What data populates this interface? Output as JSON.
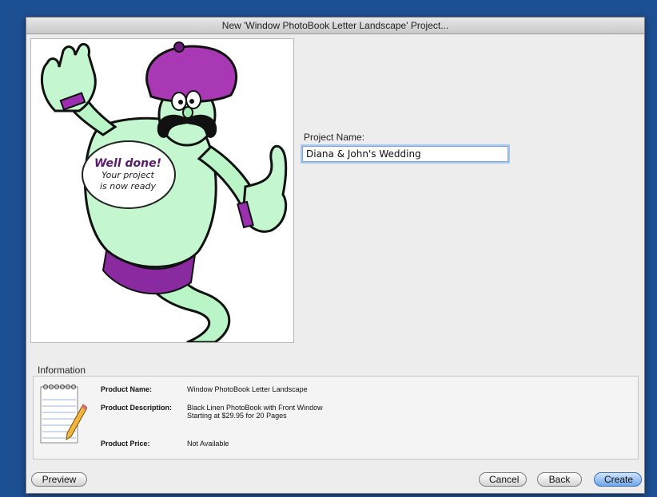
{
  "window": {
    "title": "New 'Window PhotoBook Letter Landscape' Project..."
  },
  "illustration": {
    "bubble_title": "Well done!",
    "bubble_line1": "Your project",
    "bubble_line2": "is now ready"
  },
  "project_name": {
    "label": "Project Name:",
    "value": "Diana & John's Wedding"
  },
  "information": {
    "title": "Information",
    "product_name_label": "Product Name:",
    "product_name_value": "Window PhotoBook Letter Landscape",
    "product_description_label": "Product Description:",
    "product_description_line1": "Black Linen PhotoBook with Front Window",
    "product_description_line2": "Starting at $29.95 for 20 Pages",
    "product_price_label": "Product Price:",
    "product_price_value": "Not Available"
  },
  "buttons": {
    "preview": "Preview",
    "cancel": "Cancel",
    "back": "Back",
    "create": "Create"
  },
  "colors": {
    "desktop": "#1d4f93",
    "genie_body": "#b9f5c6",
    "turban": "#a838b4",
    "primary_button": "#6ea6ea"
  }
}
